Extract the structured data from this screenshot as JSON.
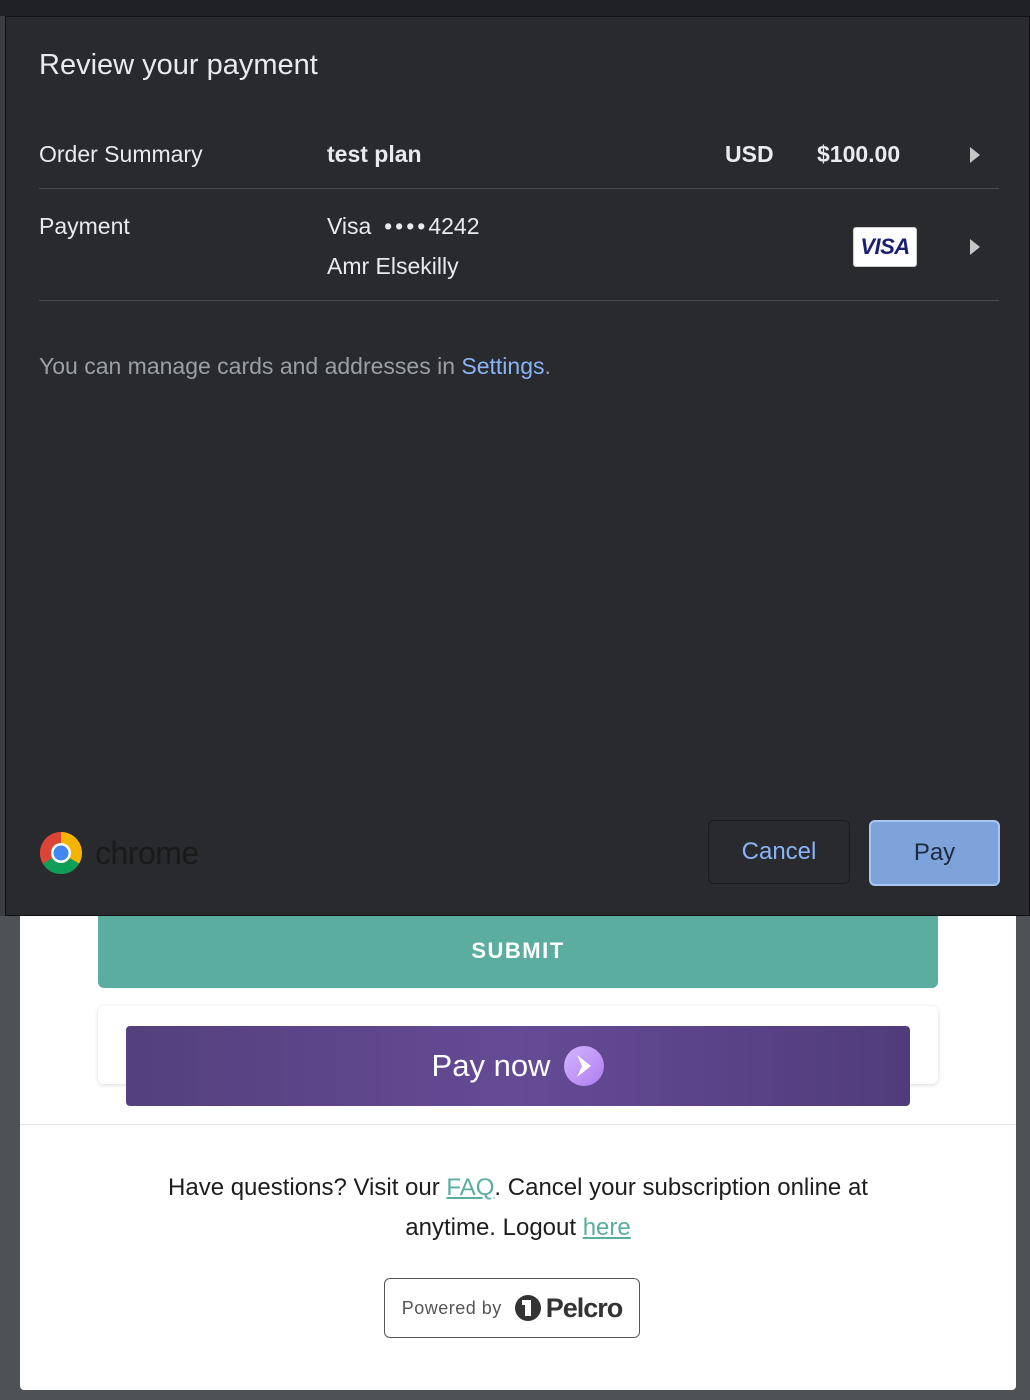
{
  "dialog": {
    "title": "Review your payment",
    "order_summary": {
      "label": "Order Summary",
      "item": "test plan",
      "currency": "USD",
      "amount": "$100.00"
    },
    "payment": {
      "label": "Payment",
      "card_type": "Visa",
      "card_mask": "••••",
      "card_last4": "4242",
      "cardholder": "Amr Elsekilly",
      "card_brand_badge": "VISA"
    },
    "manage_text": "You can manage cards and addresses in ",
    "settings_link": "Settings",
    "manage_suffix": ".",
    "brand": "chrome",
    "cancel_label": "Cancel",
    "pay_label": "Pay"
  },
  "page": {
    "submit_label": "SUBMIT",
    "pay_now_label": "Pay now",
    "faq": {
      "prefix": "Have questions? Visit our ",
      "faq_link": "FAQ",
      "middle": ". Cancel your subscription online at",
      "line2_prefix": "anytime. Logout ",
      "here_link": "here"
    },
    "powered_by": "Powered by",
    "powered_brand": "Pelcro"
  },
  "colors": {
    "dialog_bg": "#292a2d",
    "link_blue": "#8ab4f8",
    "submit_teal": "#5aad9f",
    "paynow_purple": "#5b4489"
  }
}
